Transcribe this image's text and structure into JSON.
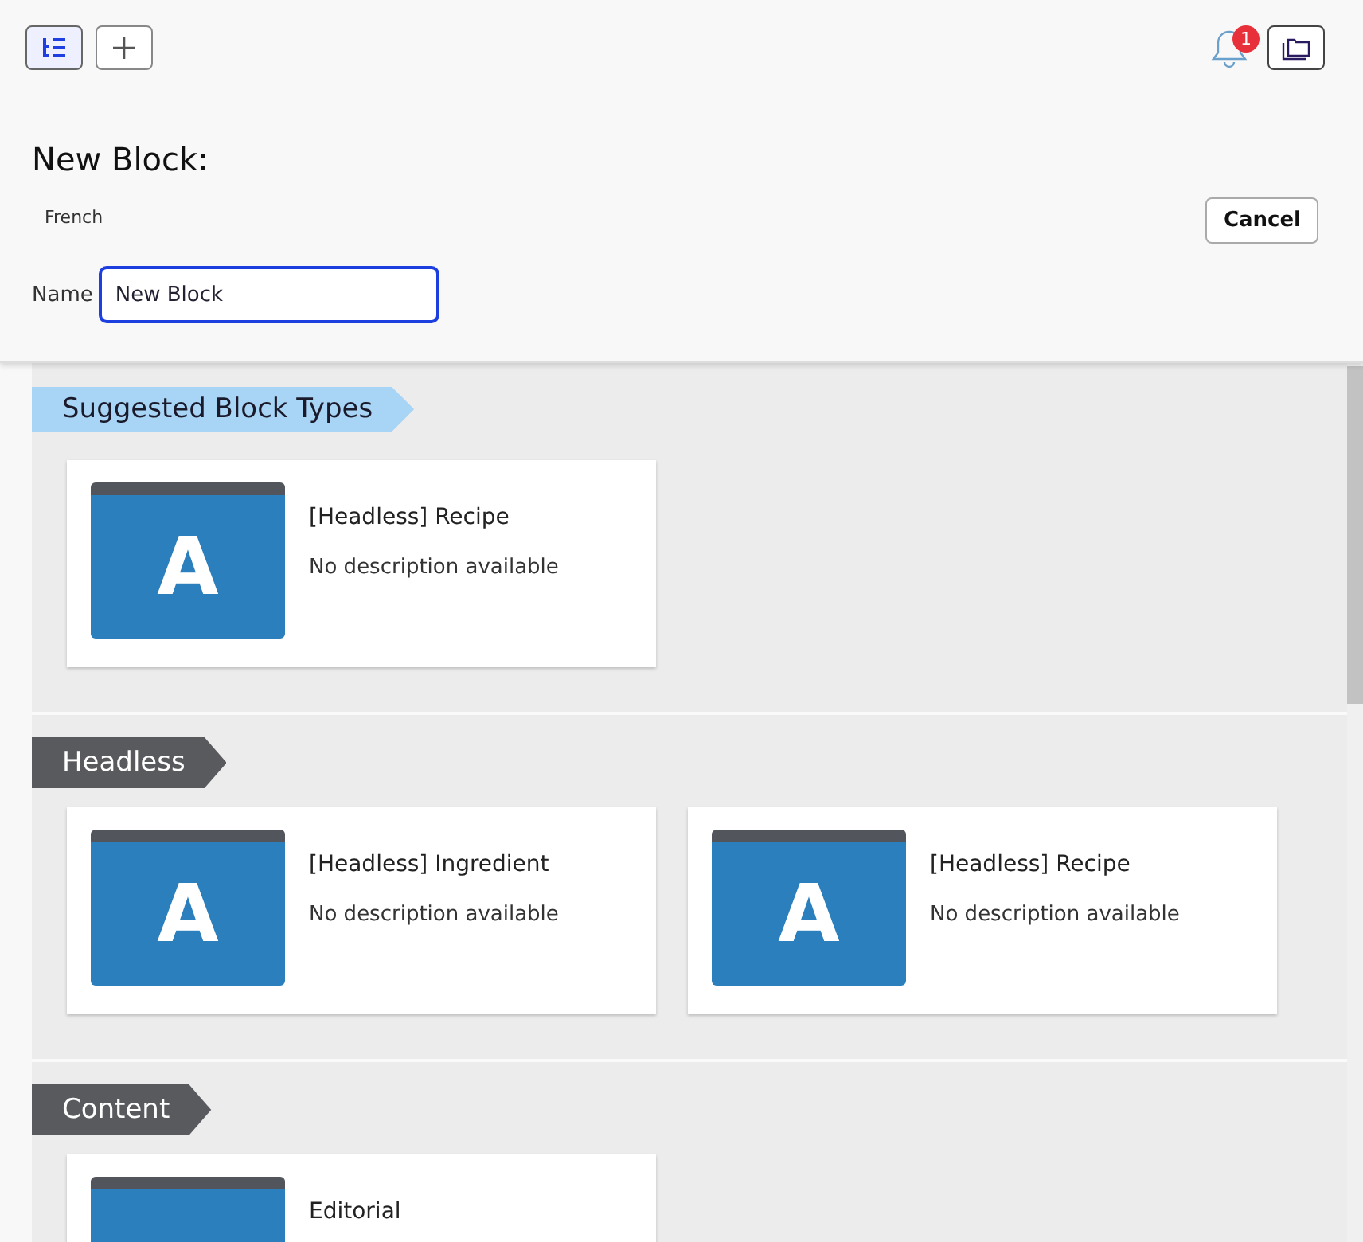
{
  "toolbar": {
    "notification_count": "1"
  },
  "title": "New Block:",
  "language": "French",
  "cancel_button": "Cancel",
  "name_field": {
    "label": "Name",
    "value": "New Block"
  },
  "sections": [
    {
      "title": "Suggested Block Types",
      "kind": "suggested",
      "cards": [
        {
          "icon_letter": "A",
          "title": "[Headless] Recipe",
          "description": "No description available"
        }
      ]
    },
    {
      "title": "Headless",
      "kind": "category",
      "cards": [
        {
          "icon_letter": "A",
          "title": "[Headless] Ingredient",
          "description": "No description available"
        },
        {
          "icon_letter": "A",
          "title": "[Headless] Recipe",
          "description": "No description available"
        }
      ]
    },
    {
      "title": "Content",
      "kind": "category",
      "cards": [
        {
          "title": "Editorial"
        }
      ]
    }
  ]
}
